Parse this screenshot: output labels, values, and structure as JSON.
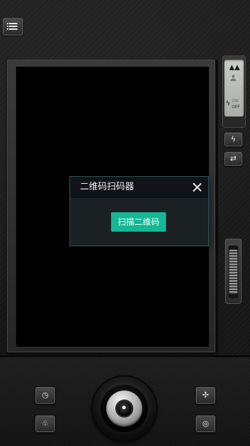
{
  "camera": {
    "menu_icon": "list-menu-icon",
    "mode_dial": {
      "landscape_icon": "mountain-icon",
      "portrait_icon": "person-icon",
      "flash_icon": "flash-icon",
      "flash_on_label": "ON",
      "flash_off_label": "OFF"
    },
    "side_buttons": {
      "flash_icon": "flash-icon",
      "switch_camera_icon": "camera-switch-icon"
    },
    "bottom_controls": {
      "timer_icon": "timer-icon",
      "filter_icon": "filter-icon",
      "effects_icon": "effects-icon",
      "gallery_icon": "gallery-icon",
      "shutter_icon": "shutter-button"
    }
  },
  "dialog": {
    "title": "二维码扫码器",
    "close_icon": "close-icon",
    "scan_button_label": "扫描二维码",
    "accent_color": "#14b894"
  }
}
